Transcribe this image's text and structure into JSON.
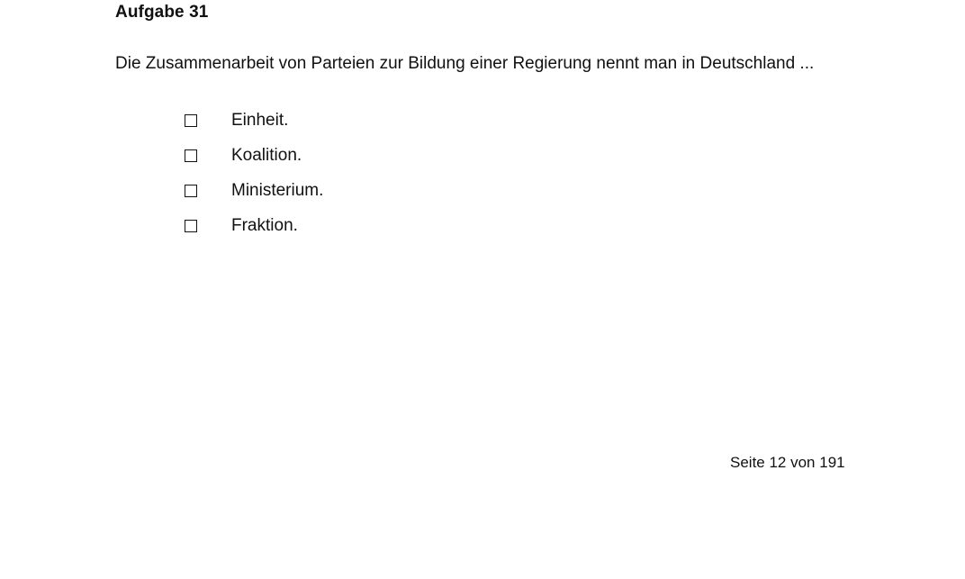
{
  "task": {
    "title": "Aufgabe 31",
    "question": "Die Zusammenarbeit von Parteien zur Bildung einer Regierung nennt man in Deutschland ...",
    "options": [
      {
        "label": "Einheit.",
        "checked": false
      },
      {
        "label": "Koalition.",
        "checked": false
      },
      {
        "label": "Ministerium.",
        "checked": false
      },
      {
        "label": "Fraktion.",
        "checked": false
      }
    ]
  },
  "footer": {
    "page_label": "Seite 12 von 191"
  }
}
